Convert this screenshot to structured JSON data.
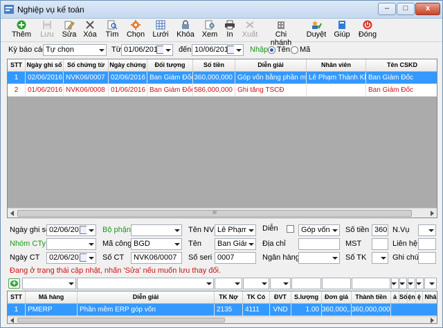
{
  "window": {
    "title": "Nghiệp vụ kế toán",
    "btn_min": "–",
    "btn_max": "□",
    "btn_close": "x"
  },
  "toolbar": [
    {
      "id": "them",
      "label": "Thêm",
      "icon": "add-icon",
      "enabled": true
    },
    {
      "id": "luu",
      "label": "Lưu",
      "icon": "save-icon",
      "enabled": false
    },
    {
      "id": "sua",
      "label": "Sửa",
      "icon": "edit-icon",
      "enabled": true
    },
    {
      "id": "xoa",
      "label": "Xóa",
      "icon": "delete-icon",
      "enabled": true
    },
    {
      "id": "tim",
      "label": "Tìm",
      "icon": "search-icon",
      "enabled": true
    },
    {
      "id": "chon",
      "label": "Chọn",
      "icon": "gear-icon",
      "enabled": true
    },
    {
      "id": "luoi",
      "label": "Lưới",
      "icon": "grid-icon",
      "enabled": true
    },
    {
      "id": "khoa",
      "label": "Khóa",
      "icon": "lock-icon",
      "enabled": true
    },
    {
      "id": "xem",
      "label": "Xem",
      "icon": "preview-icon",
      "enabled": true
    },
    {
      "id": "in",
      "label": "In",
      "icon": "printer-icon",
      "enabled": true
    },
    {
      "id": "xuat",
      "label": "Xuất",
      "icon": "export-icon",
      "enabled": false
    },
    {
      "id": "chinhanh",
      "label": "Chi nhánh",
      "icon": "branch-icon",
      "enabled": true
    },
    {
      "id": "duyet",
      "label": "Duyệt",
      "icon": "approve-icon",
      "enabled": true
    },
    {
      "id": "giup",
      "label": "Giúp",
      "icon": "help-book-icon",
      "enabled": true
    },
    {
      "id": "dong",
      "label": "Đóng",
      "icon": "power-icon",
      "enabled": true
    }
  ],
  "filter": {
    "period_label": "Kỳ báo cáo",
    "period_value": "Tự chọn",
    "from_label": "Từ",
    "from_value": "01/06/2016",
    "to_label": "đến",
    "to_value": "10/06/2016",
    "entry_label": "Nhập",
    "opt_name": "Tên",
    "opt_code": "Mã"
  },
  "main_grid": {
    "columns": [
      "STT",
      "Ngày ghi sổ",
      "Số chứng từ",
      "Ngày chứng",
      "Đối tượng",
      "Số tiền",
      "Diễn giải",
      "Nhân viên",
      "Tên CSKD"
    ],
    "rows": [
      [
        "1",
        "02/06/2016",
        "NVK06/0007",
        "02/06/2016",
        "Ban Giám Đốc",
        "360,000,000",
        "Góp vốn bằng phần mềm",
        "Lê Phạm Thành Khôi",
        "Ban Giám Đốc"
      ],
      [
        "2",
        "01/06/2016",
        "NVK06/0008",
        "01/06/2016",
        "Ban Giám Đốc",
        "586,000,000",
        "Ghi tăng TSCĐ",
        "",
        "Ban Giám Đốc"
      ]
    ],
    "scroll_mark": "III"
  },
  "form": {
    "ngay_ghi_so_label": "Ngày ghi sổ",
    "ngay_ghi_so": "02/06/2016",
    "bo_phan_label": "Bộ phận",
    "bo_phan": "",
    "ten_nv_label": "Tên NV",
    "ten_nv": "Lê Phạm T",
    "dien_label": "Diễn",
    "dien_giai": "Góp vốn bằ",
    "so_tien_label": "Số tiền",
    "so_tien": "360,",
    "nvu_label": "N.Vụ",
    "nvu": "",
    "nhom_cty_label": "Nhóm CTy",
    "nhom_cty": "",
    "ma_cong_label": "Mã công",
    "ma_cong": "BGD",
    "ten_label": "Tên",
    "ten": "Ban Giám Đ",
    "dia_chi_label": "Địa chỉ",
    "dia_chi": "",
    "mst_label": "MST",
    "mst": "",
    "lien_he_label": "Liên hệ",
    "lien_he": "",
    "ngay_ct_label": "Ngày CT",
    "ngay_ct": "02/06/2016",
    "so_ct_label": "Số CT",
    "so_ct": "NVK06/0007",
    "so_seri_label": "Số seri",
    "so_seri": "0007",
    "ngan_hang_label": "Ngân hàng",
    "ngan_hang": "",
    "so_tk_label": "Số TK",
    "so_tk": "",
    "ghi_chu_label": "Ghi chú",
    "ghi_chu": ""
  },
  "status_message": "Đang ở trạng thái cập nhật, nhấn 'Sửa' nếu muốn lưu thay đổi.",
  "detail_grid": {
    "columns": [
      "STT",
      "Mã hàng",
      "Diễn giải",
      "TK Nợ",
      "TK Có",
      "ĐVT",
      "S.lượng",
      "Đơn giá",
      "Thành tiền",
      "ả",
      "Số",
      "ện",
      "ệ",
      "Nhâ"
    ],
    "rows": [
      [
        "1",
        "PMERP",
        "Phần mềm ERP góp vốn",
        "2135",
        "4111",
        "VND",
        "1.00",
        "360,000,...",
        "360,000,000"
      ]
    ]
  },
  "colors": {
    "selection": "#3399ff",
    "label_green": "#1a9a1a",
    "warning_red": "#d01010"
  }
}
